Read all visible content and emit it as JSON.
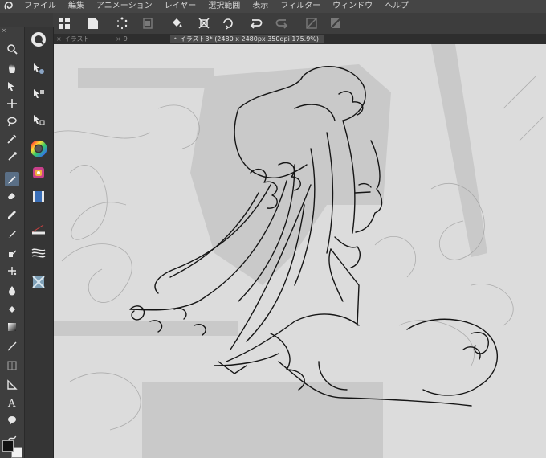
{
  "menu": {
    "items": [
      "ファイル",
      "編集",
      "アニメーション",
      "レイヤー",
      "選択範囲",
      "表示",
      "フィルター",
      "ウィンドウ",
      "ヘルプ"
    ]
  },
  "tabs": [
    {
      "label": "イラスト",
      "active": false
    },
    {
      "label": "9",
      "active": false
    },
    {
      "label": "イラスト3* (2480 x 2480px 350dpi 175.9%)",
      "active": true
    }
  ],
  "tool_header": "×",
  "colors": {
    "accent": "#5a6f86",
    "menubar": "#454545",
    "panel": "#3e3e3e",
    "canvas": "#dcdcdc"
  },
  "tool_icons": [
    "magnifier-icon",
    "hand-icon",
    "zoom-icon",
    "move-icon",
    "lasso-icon",
    "eyedropper-icon",
    "pen-icon",
    "pencil-icon",
    "eraser-icon",
    "brush-icon",
    "blend-icon",
    "decoration-icon",
    "fill-icon",
    "gradient-icon",
    "line-icon",
    "frame-icon",
    "ruler-icon",
    "text-icon",
    "balloon-icon",
    "correct-line-icon"
  ],
  "sub_icons": [
    "q-logo-icon",
    "sub-move-icon",
    "sub-rotate-icon",
    "sub-transform-icon",
    "color-wheel-icon",
    "color-set-icon",
    "layer-property-icon",
    "brush-size-icon",
    "stabilizer-icon",
    "navigator-icon"
  ]
}
